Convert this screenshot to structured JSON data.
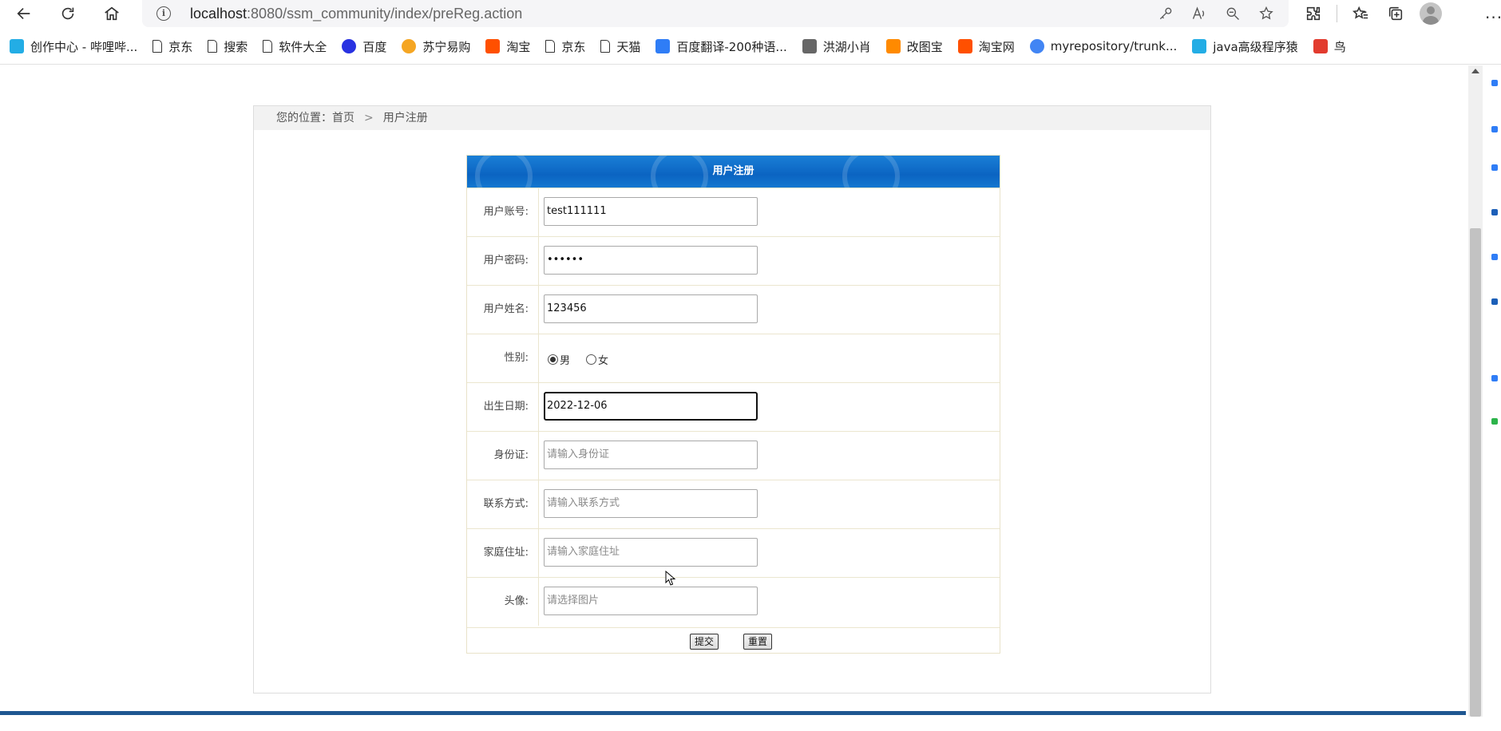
{
  "browser": {
    "url_host": "localhost",
    "url_rest": ":8080/ssm_community/index/preReg.action"
  },
  "bookmarks": [
    {
      "label": "创作中心 - 哔哩哔...",
      "icon": "bilibili-icon",
      "color": "#23ade5"
    },
    {
      "label": "京东",
      "icon": "page-icon"
    },
    {
      "label": "搜索",
      "icon": "page-icon"
    },
    {
      "label": "软件大全",
      "icon": "page-icon"
    },
    {
      "label": "百度",
      "icon": "baidu-icon",
      "color": "#2932e1"
    },
    {
      "label": "苏宁易购",
      "icon": "suning-icon",
      "color": "#f5a623"
    },
    {
      "label": "淘宝",
      "icon": "taobao-icon",
      "color": "#ff5000"
    },
    {
      "label": "京东",
      "icon": "page-icon"
    },
    {
      "label": "天猫",
      "icon": "page-icon"
    },
    {
      "label": "百度翻译-200种语...",
      "icon": "translate-icon",
      "color": "#2f7df6"
    },
    {
      "label": "洪湖小肖",
      "icon": "bird-icon",
      "color": "#666666"
    },
    {
      "label": "改图宝",
      "icon": "gaitubao-icon",
      "color": "#ff8a00"
    },
    {
      "label": "淘宝网",
      "icon": "taobao-icon",
      "color": "#ff5000"
    },
    {
      "label": "myrepository/trunk...",
      "icon": "chrome-icon",
      "color": "#4285f4"
    },
    {
      "label": "java高级程序猿",
      "icon": "bilibili-icon",
      "color": "#23ade5"
    },
    {
      "label": "鸟",
      "icon": "bird-icon",
      "color": "#e23b2e"
    }
  ],
  "breadcrumb": {
    "prefix": "您的位置：",
    "home": "首页",
    "current": "用户注册"
  },
  "form": {
    "title": "用户注册",
    "account_label": "用户账号:",
    "account_value": "test111111",
    "password_label": "用户密码:",
    "password_value": "••••••",
    "name_label": "用户姓名:",
    "name_value": "123456",
    "gender_label": "性别:",
    "gender_male": "男",
    "gender_female": "女",
    "birth_label": "出生日期:",
    "birth_value": "2022-12-06",
    "idcard_label": "身份证:",
    "idcard_placeholder": "请输入身份证",
    "contact_label": "联系方式:",
    "contact_placeholder": "请输入联系方式",
    "address_label": "家庭住址:",
    "address_placeholder": "请输入家庭住址",
    "avatar_label": "头像:",
    "avatar_placeholder": "请选择图片",
    "submit_label": "提交",
    "reset_label": "重置"
  },
  "colors": {
    "header_blue": "#0b64c2",
    "footer_blue": "#1f5791",
    "table_border": "#ebe6cf"
  }
}
